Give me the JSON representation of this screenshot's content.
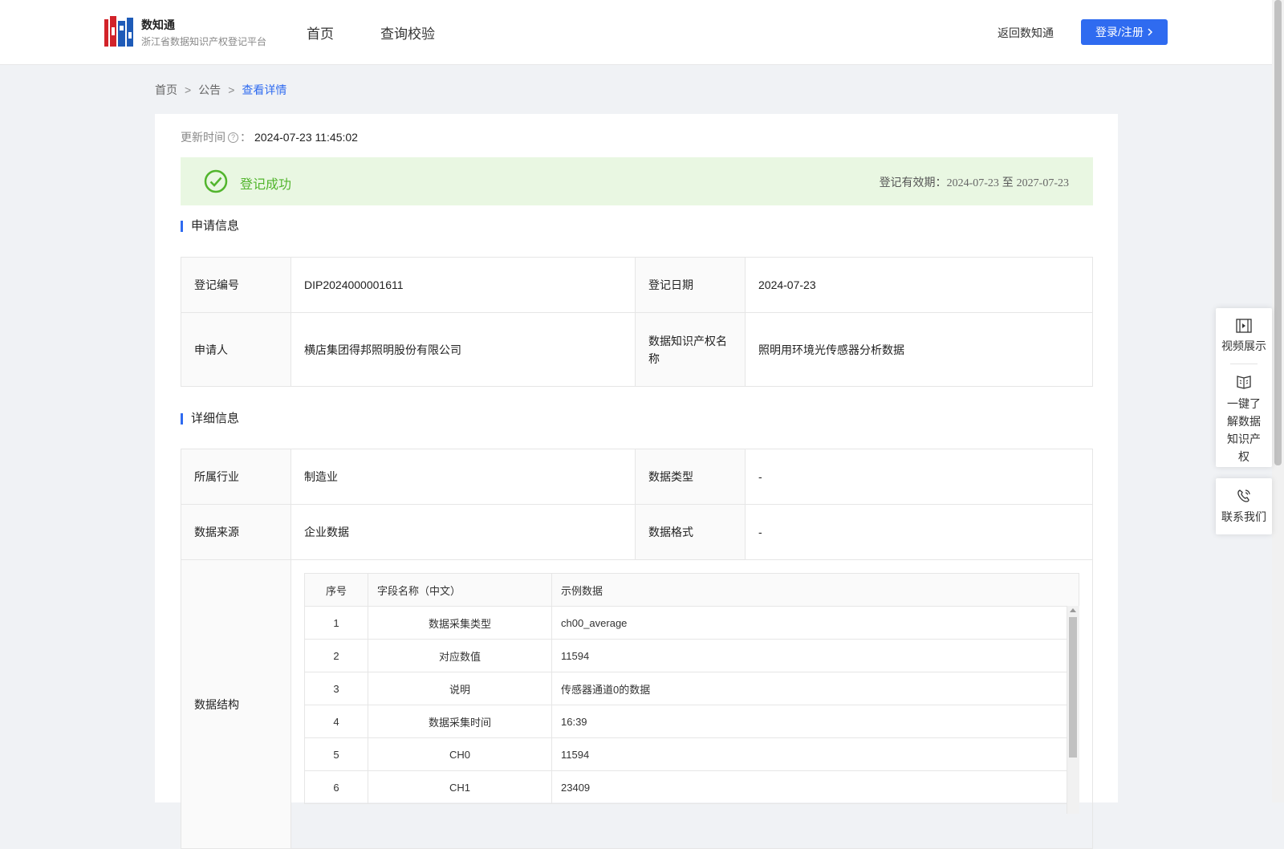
{
  "header": {
    "brand_title": "数知通",
    "brand_subtitle": "浙江省数据知识产权登记平台",
    "nav": [
      {
        "label": "首页"
      },
      {
        "label": "查询校验"
      }
    ],
    "back_label": "返回数知通",
    "login_label": "登录/注册",
    "accent": "#2f6bf0"
  },
  "breadcrumb": {
    "home": "首页",
    "notice": "公告",
    "current": "查看详情",
    "separator": ">"
  },
  "update": {
    "label": "更新时间",
    "help_glyph": "?",
    "colon": "：",
    "value": "2024-07-23 11:45:02"
  },
  "status": {
    "text": "登记成功",
    "validity_label": "登记有效期：",
    "validity_start": "2024-07-23",
    "validity_to": "至",
    "validity_end": "2027-07-23",
    "color": "#52b52d"
  },
  "application": {
    "title": "申请信息",
    "reg_no_label": "登记编号",
    "reg_no": "DIP2024000001611",
    "reg_date_label": "登记日期",
    "reg_date": "2024-07-23",
    "applicant_label": "申请人",
    "applicant": "横店集团得邦照明股份有限公司",
    "ip_name_label": "数据知识产权名称",
    "ip_name": "照明用环境光传感器分析数据"
  },
  "detail": {
    "title": "详细信息",
    "industry_label": "所属行业",
    "industry": "制造业",
    "data_type_label": "数据类型",
    "data_type": "-",
    "source_label": "数据来源",
    "source": "企业数据",
    "format_label": "数据格式",
    "format": "-",
    "structure_label": "数据结构",
    "fields_header": {
      "no": "序号",
      "name": "字段名称（中文）",
      "example": "示例数据"
    },
    "fields": [
      {
        "no": "1",
        "name": "数据采集类型",
        "example": "ch00_average"
      },
      {
        "no": "2",
        "name": "对应数值",
        "example": "11594"
      },
      {
        "no": "3",
        "name": "说明",
        "example": "传感器通道0的数据"
      },
      {
        "no": "4",
        "name": "数据采集时间",
        "example": "16:39"
      },
      {
        "no": "5",
        "name": "CH0",
        "example": "11594"
      },
      {
        "no": "6",
        "name": "CH1",
        "example": "23409"
      }
    ]
  },
  "float_menu": {
    "video": "视频展示",
    "learn": "一键了解数据知识产权",
    "contact": "联系我们"
  }
}
